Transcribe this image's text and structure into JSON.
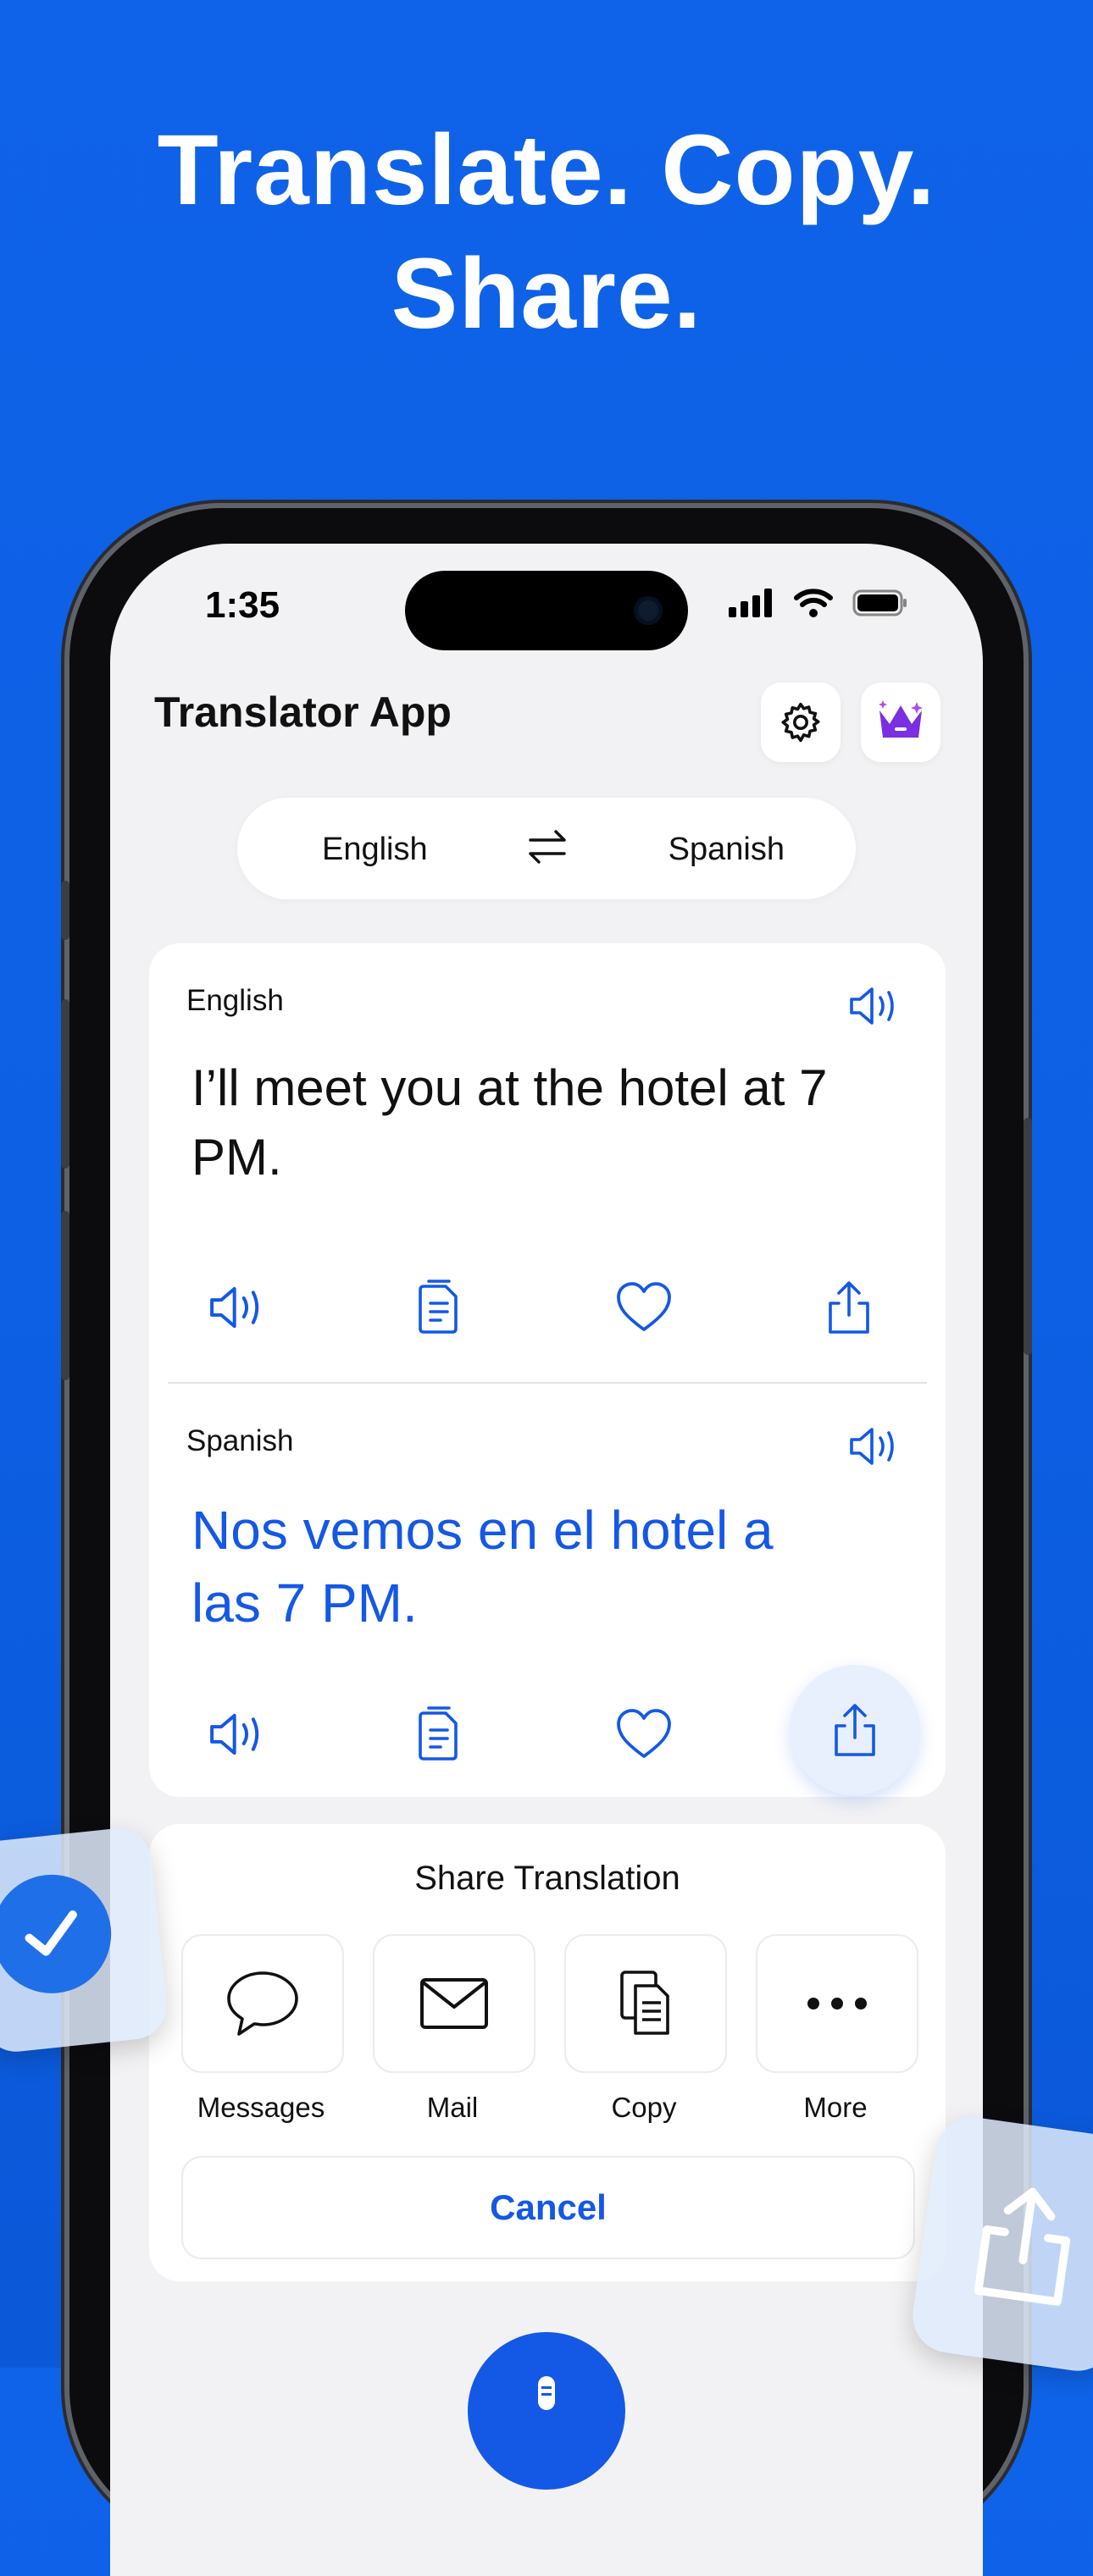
{
  "headline": {
    "line1": "Translate. Copy.",
    "line2": "Share."
  },
  "status": {
    "time": "1:35"
  },
  "app": {
    "title": "Translator App"
  },
  "icons": {
    "settings": "gear-icon",
    "premium": "crown-icon",
    "swap": "swap-arrows-icon",
    "speaker": "speaker-icon",
    "copy": "copy-icon",
    "favorite": "heart-icon",
    "share": "share-icon",
    "messages": "speech-bubble-icon",
    "mail": "envelope-icon",
    "more": "ellipsis-icon",
    "mic": "microphone-icon"
  },
  "languages": {
    "source": "English",
    "target": "Spanish"
  },
  "source": {
    "label": "English",
    "text": "I’ll meet you at the hotel at 7 PM."
  },
  "target": {
    "label": "Spanish",
    "text": "Nos vemos en el hotel a las 7 PM."
  },
  "share_sheet": {
    "title": "Share Translation",
    "options": [
      {
        "label": "Messages"
      },
      {
        "label": "Mail"
      },
      {
        "label": "Copy"
      },
      {
        "label": "More"
      }
    ],
    "cancel": "Cancel"
  },
  "colors": {
    "accent": "#1458e6",
    "background": "#0f63e8",
    "premium": "#7a2fe0"
  }
}
